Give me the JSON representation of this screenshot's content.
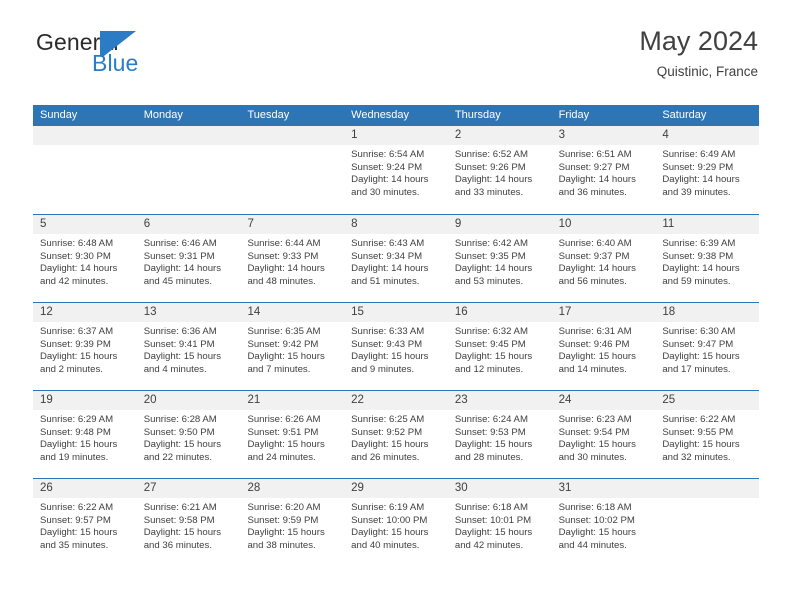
{
  "brand": {
    "name_top": "General",
    "name_bottom": "Blue",
    "mark_icon": "blue-flag-triangle-icon",
    "color_text": "#2b2b2b",
    "color_accent": "#2b7cc4"
  },
  "header": {
    "title": "May 2024",
    "subtitle": "Quistinic, France"
  },
  "colors": {
    "header_bg": "#2e75b6",
    "header_text": "#ffffff",
    "day_band_bg": "#f1f1f1",
    "body_text": "#404040",
    "week_divider": "#2e75b6"
  },
  "weekday_headers": [
    "Sunday",
    "Monday",
    "Tuesday",
    "Wednesday",
    "Thursday",
    "Friday",
    "Saturday"
  ],
  "labels": {
    "sunrise_prefix": "Sunrise:",
    "sunset_prefix": "Sunset:",
    "daylight_prefix": "Daylight:"
  },
  "weeks": [
    [
      {
        "day": "",
        "empty": true,
        "sunrise": "",
        "sunset": "",
        "daylight_1": "",
        "daylight_2": ""
      },
      {
        "day": "",
        "empty": true,
        "sunrise": "",
        "sunset": "",
        "daylight_1": "",
        "daylight_2": ""
      },
      {
        "day": "",
        "empty": true,
        "sunrise": "",
        "sunset": "",
        "daylight_1": "",
        "daylight_2": ""
      },
      {
        "day": "1",
        "empty": false,
        "sunrise": "Sunrise: 6:54 AM",
        "sunset": "Sunset: 9:24 PM",
        "daylight_1": "Daylight: 14 hours",
        "daylight_2": "and 30 minutes."
      },
      {
        "day": "2",
        "empty": false,
        "sunrise": "Sunrise: 6:52 AM",
        "sunset": "Sunset: 9:26 PM",
        "daylight_1": "Daylight: 14 hours",
        "daylight_2": "and 33 minutes."
      },
      {
        "day": "3",
        "empty": false,
        "sunrise": "Sunrise: 6:51 AM",
        "sunset": "Sunset: 9:27 PM",
        "daylight_1": "Daylight: 14 hours",
        "daylight_2": "and 36 minutes."
      },
      {
        "day": "4",
        "empty": false,
        "sunrise": "Sunrise: 6:49 AM",
        "sunset": "Sunset: 9:29 PM",
        "daylight_1": "Daylight: 14 hours",
        "daylight_2": "and 39 minutes."
      }
    ],
    [
      {
        "day": "5",
        "empty": false,
        "sunrise": "Sunrise: 6:48 AM",
        "sunset": "Sunset: 9:30 PM",
        "daylight_1": "Daylight: 14 hours",
        "daylight_2": "and 42 minutes."
      },
      {
        "day": "6",
        "empty": false,
        "sunrise": "Sunrise: 6:46 AM",
        "sunset": "Sunset: 9:31 PM",
        "daylight_1": "Daylight: 14 hours",
        "daylight_2": "and 45 minutes."
      },
      {
        "day": "7",
        "empty": false,
        "sunrise": "Sunrise: 6:44 AM",
        "sunset": "Sunset: 9:33 PM",
        "daylight_1": "Daylight: 14 hours",
        "daylight_2": "and 48 minutes."
      },
      {
        "day": "8",
        "empty": false,
        "sunrise": "Sunrise: 6:43 AM",
        "sunset": "Sunset: 9:34 PM",
        "daylight_1": "Daylight: 14 hours",
        "daylight_2": "and 51 minutes."
      },
      {
        "day": "9",
        "empty": false,
        "sunrise": "Sunrise: 6:42 AM",
        "sunset": "Sunset: 9:35 PM",
        "daylight_1": "Daylight: 14 hours",
        "daylight_2": "and 53 minutes."
      },
      {
        "day": "10",
        "empty": false,
        "sunrise": "Sunrise: 6:40 AM",
        "sunset": "Sunset: 9:37 PM",
        "daylight_1": "Daylight: 14 hours",
        "daylight_2": "and 56 minutes."
      },
      {
        "day": "11",
        "empty": false,
        "sunrise": "Sunrise: 6:39 AM",
        "sunset": "Sunset: 9:38 PM",
        "daylight_1": "Daylight: 14 hours",
        "daylight_2": "and 59 minutes."
      }
    ],
    [
      {
        "day": "12",
        "empty": false,
        "sunrise": "Sunrise: 6:37 AM",
        "sunset": "Sunset: 9:39 PM",
        "daylight_1": "Daylight: 15 hours",
        "daylight_2": "and 2 minutes."
      },
      {
        "day": "13",
        "empty": false,
        "sunrise": "Sunrise: 6:36 AM",
        "sunset": "Sunset: 9:41 PM",
        "daylight_1": "Daylight: 15 hours",
        "daylight_2": "and 4 minutes."
      },
      {
        "day": "14",
        "empty": false,
        "sunrise": "Sunrise: 6:35 AM",
        "sunset": "Sunset: 9:42 PM",
        "daylight_1": "Daylight: 15 hours",
        "daylight_2": "and 7 minutes."
      },
      {
        "day": "15",
        "empty": false,
        "sunrise": "Sunrise: 6:33 AM",
        "sunset": "Sunset: 9:43 PM",
        "daylight_1": "Daylight: 15 hours",
        "daylight_2": "and 9 minutes."
      },
      {
        "day": "16",
        "empty": false,
        "sunrise": "Sunrise: 6:32 AM",
        "sunset": "Sunset: 9:45 PM",
        "daylight_1": "Daylight: 15 hours",
        "daylight_2": "and 12 minutes."
      },
      {
        "day": "17",
        "empty": false,
        "sunrise": "Sunrise: 6:31 AM",
        "sunset": "Sunset: 9:46 PM",
        "daylight_1": "Daylight: 15 hours",
        "daylight_2": "and 14 minutes."
      },
      {
        "day": "18",
        "empty": false,
        "sunrise": "Sunrise: 6:30 AM",
        "sunset": "Sunset: 9:47 PM",
        "daylight_1": "Daylight: 15 hours",
        "daylight_2": "and 17 minutes."
      }
    ],
    [
      {
        "day": "19",
        "empty": false,
        "sunrise": "Sunrise: 6:29 AM",
        "sunset": "Sunset: 9:48 PM",
        "daylight_1": "Daylight: 15 hours",
        "daylight_2": "and 19 minutes."
      },
      {
        "day": "20",
        "empty": false,
        "sunrise": "Sunrise: 6:28 AM",
        "sunset": "Sunset: 9:50 PM",
        "daylight_1": "Daylight: 15 hours",
        "daylight_2": "and 22 minutes."
      },
      {
        "day": "21",
        "empty": false,
        "sunrise": "Sunrise: 6:26 AM",
        "sunset": "Sunset: 9:51 PM",
        "daylight_1": "Daylight: 15 hours",
        "daylight_2": "and 24 minutes."
      },
      {
        "day": "22",
        "empty": false,
        "sunrise": "Sunrise: 6:25 AM",
        "sunset": "Sunset: 9:52 PM",
        "daylight_1": "Daylight: 15 hours",
        "daylight_2": "and 26 minutes."
      },
      {
        "day": "23",
        "empty": false,
        "sunrise": "Sunrise: 6:24 AM",
        "sunset": "Sunset: 9:53 PM",
        "daylight_1": "Daylight: 15 hours",
        "daylight_2": "and 28 minutes."
      },
      {
        "day": "24",
        "empty": false,
        "sunrise": "Sunrise: 6:23 AM",
        "sunset": "Sunset: 9:54 PM",
        "daylight_1": "Daylight: 15 hours",
        "daylight_2": "and 30 minutes."
      },
      {
        "day": "25",
        "empty": false,
        "sunrise": "Sunrise: 6:22 AM",
        "sunset": "Sunset: 9:55 PM",
        "daylight_1": "Daylight: 15 hours",
        "daylight_2": "and 32 minutes."
      }
    ],
    [
      {
        "day": "26",
        "empty": false,
        "sunrise": "Sunrise: 6:22 AM",
        "sunset": "Sunset: 9:57 PM",
        "daylight_1": "Daylight: 15 hours",
        "daylight_2": "and 35 minutes."
      },
      {
        "day": "27",
        "empty": false,
        "sunrise": "Sunrise: 6:21 AM",
        "sunset": "Sunset: 9:58 PM",
        "daylight_1": "Daylight: 15 hours",
        "daylight_2": "and 36 minutes."
      },
      {
        "day": "28",
        "empty": false,
        "sunrise": "Sunrise: 6:20 AM",
        "sunset": "Sunset: 9:59 PM",
        "daylight_1": "Daylight: 15 hours",
        "daylight_2": "and 38 minutes."
      },
      {
        "day": "29",
        "empty": false,
        "sunrise": "Sunrise: 6:19 AM",
        "sunset": "Sunset: 10:00 PM",
        "daylight_1": "Daylight: 15 hours",
        "daylight_2": "and 40 minutes."
      },
      {
        "day": "30",
        "empty": false,
        "sunrise": "Sunrise: 6:18 AM",
        "sunset": "Sunset: 10:01 PM",
        "daylight_1": "Daylight: 15 hours",
        "daylight_2": "and 42 minutes."
      },
      {
        "day": "31",
        "empty": false,
        "sunrise": "Sunrise: 6:18 AM",
        "sunset": "Sunset: 10:02 PM",
        "daylight_1": "Daylight: 15 hours",
        "daylight_2": "and 44 minutes."
      },
      {
        "day": "",
        "empty": true,
        "sunrise": "",
        "sunset": "",
        "daylight_1": "",
        "daylight_2": ""
      }
    ]
  ]
}
